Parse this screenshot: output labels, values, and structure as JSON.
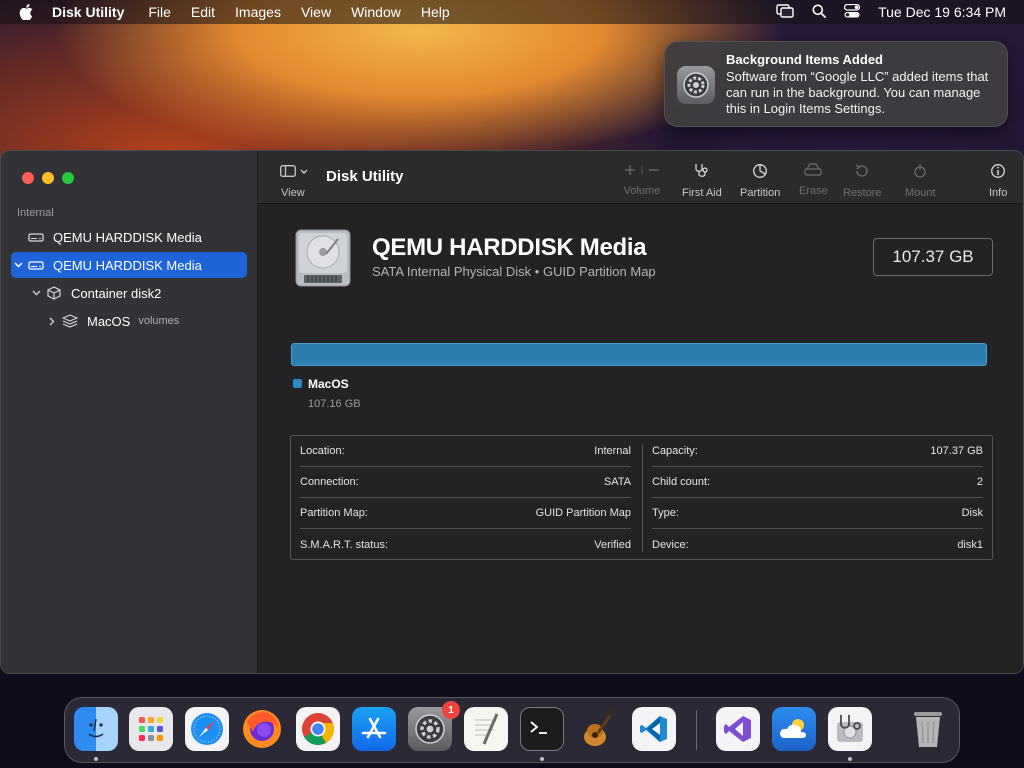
{
  "menubar": {
    "app_name": "Disk Utility",
    "items": [
      "File",
      "Edit",
      "Images",
      "View",
      "Window",
      "Help"
    ],
    "clock": "Tue Dec 19  6:34 PM"
  },
  "notification": {
    "title": "Background Items Added",
    "body": "Software from “Google LLC” added items that can run in the background. You can manage this in Login Items Settings."
  },
  "sidebar": {
    "section": "Internal",
    "items": [
      {
        "label": "QEMU HARDDISK Media"
      },
      {
        "label": "QEMU HARDDISK Media"
      },
      {
        "label": "Container disk2"
      },
      {
        "label": "MacOS",
        "sub": "volumes"
      }
    ]
  },
  "toolbar": {
    "view_label": "View",
    "title": "Disk Utility",
    "buttons": {
      "volume": "Volume",
      "first_aid": "First Aid",
      "partition": "Partition",
      "erase": "Erase",
      "restore": "Restore",
      "mount": "Mount",
      "info": "Info"
    }
  },
  "disk": {
    "name": "QEMU HARDDISK Media",
    "description": "SATA Internal Physical Disk • GUID Partition Map",
    "size": "107.37 GB"
  },
  "usage": {
    "fill_fraction": 1.0,
    "color": "#2c7eb0",
    "legend_name": "MacOS",
    "legend_size": "107.16 GB"
  },
  "info": {
    "left": [
      {
        "label": "Location:",
        "value": "Internal"
      },
      {
        "label": "Connection:",
        "value": "SATA"
      },
      {
        "label": "Partition Map:",
        "value": "GUID Partition Map"
      },
      {
        "label": "S.M.A.R.T. status:",
        "value": "Verified"
      }
    ],
    "right": [
      {
        "label": "Capacity:",
        "value": "107.37 GB"
      },
      {
        "label": "Child count:",
        "value": "2"
      },
      {
        "label": "Type:",
        "value": "Disk"
      },
      {
        "label": "Device:",
        "value": "disk1"
      }
    ]
  },
  "dock": {
    "settings_badge": "1"
  }
}
